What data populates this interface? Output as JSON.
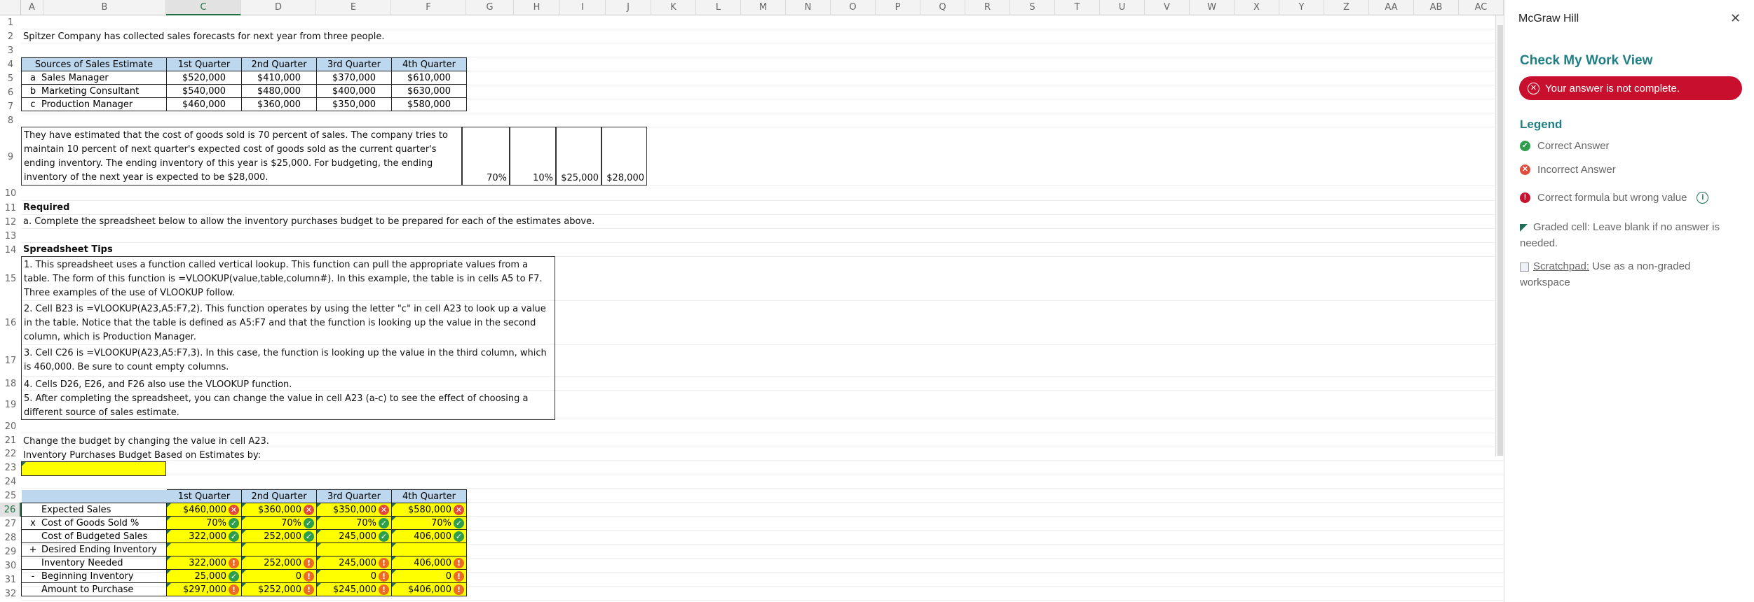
{
  "columns": [
    "A",
    "B",
    "C",
    "D",
    "E",
    "F",
    "G",
    "H",
    "I",
    "J",
    "K",
    "L",
    "M",
    "N",
    "O",
    "P",
    "Q",
    "R",
    "S",
    "T",
    "U",
    "V",
    "W",
    "X",
    "Y",
    "Z",
    "AA",
    "AB",
    "AC"
  ],
  "rows": [
    "1",
    "2",
    "3",
    "4",
    "5",
    "6",
    "7",
    "8",
    "9",
    "10",
    "11",
    "12",
    "13",
    "14",
    "15",
    "16",
    "17",
    "18",
    "19",
    "20",
    "21",
    "22",
    "23",
    "24",
    "25",
    "26",
    "27",
    "28",
    "29",
    "30",
    "31",
    "32"
  ],
  "intro": "Spitzer Company has collected sales forecasts for next year from three people.",
  "sources": {
    "header": [
      "Sources of Sales Estimate",
      "1st Quarter",
      "2nd Quarter",
      "3rd Quarter",
      "4th Quarter"
    ],
    "rows": [
      {
        "letter": "a",
        "name": "Sales Manager",
        "q": [
          "$520,000",
          "$410,000",
          "$370,000",
          "$610,000"
        ]
      },
      {
        "letter": "b",
        "name": "Marketing Consultant",
        "q": [
          "$540,000",
          "$480,000",
          "$400,000",
          "$630,000"
        ]
      },
      {
        "letter": "c",
        "name": "Production Manager",
        "q": [
          "$460,000",
          "$360,000",
          "$350,000",
          "$580,000"
        ]
      }
    ]
  },
  "estimate_text": "They have estimated that the cost of goods sold is 70 percent of sales. The company tries to maintain 10 percent of next quarter's expected cost of goods sold as the current quarter's ending inventory. The ending inventory of this year is $25,000. For budgeting, the ending inventory of the next year is expected to be $28,000.",
  "assumptions": [
    "70%",
    "10%",
    "$25,000",
    "$28,000"
  ],
  "required_label": "Required",
  "required_text": "a. Complete the spreadsheet below to allow the inventory purchases budget to be prepared for each of the estimates above.",
  "tips_label": "Spreadsheet Tips",
  "tips": [
    "1. This spreadsheet uses a function called vertical lookup. This function can pull the appropriate values from a table. The form of this function is =VLOOKUP(value,table,column#). In this example, the table is in cells A5 to F7. Three examples of the use of VLOOKUP follow.",
    "2. Cell B23 is =VLOOKUP(A23,A5:F7,2). This function operates by using the letter \"c\" in cell A23 to look up a value in the table. Notice that the table is defined as A5:F7 and that the function is looking up the value in the second column, which is Production Manager.",
    "3. Cell C26 is =VLOOKUP(A23,A5:F7,3). In this case, the function is looking up the value in the third column, which is 460,000. Be sure to count empty columns.",
    "4. Cells D26, E26, and F26 also use the VLOOKUP function.",
    "5. After completing the spreadsheet, you can change the value in cell A23 (a-c) to see the effect of choosing a different source of sales estimate."
  ],
  "change_text": "Change the budget by changing the value in cell A23.",
  "budget_title": "Inventory Purchases Budget Based on Estimates by:",
  "budget": {
    "header": [
      "1st Quarter",
      "2nd Quarter",
      "3rd Quarter",
      "4th Quarter"
    ],
    "rows": [
      {
        "op": "",
        "label": "Expected Sales",
        "cells": [
          {
            "v": "$460,000",
            "s": "bad"
          },
          {
            "v": "$360,000",
            "s": "bad"
          },
          {
            "v": "$350,000",
            "s": "bad"
          },
          {
            "v": "$580,000",
            "s": "bad"
          }
        ]
      },
      {
        "op": "x",
        "label": "Cost of Goods Sold %",
        "cells": [
          {
            "v": "70%",
            "s": "ok"
          },
          {
            "v": "70%",
            "s": "ok"
          },
          {
            "v": "70%",
            "s": "ok"
          },
          {
            "v": "70%",
            "s": "ok"
          }
        ]
      },
      {
        "op": "",
        "label": "Cost of Budgeted Sales",
        "cells": [
          {
            "v": "322,000",
            "s": "ok"
          },
          {
            "v": "252,000",
            "s": "ok"
          },
          {
            "v": "245,000",
            "s": "ok"
          },
          {
            "v": "406,000",
            "s": "ok"
          }
        ]
      },
      {
        "op": "+",
        "label": "Desired Ending Inventory",
        "cells": [
          {
            "v": "",
            "s": ""
          },
          {
            "v": "",
            "s": ""
          },
          {
            "v": "",
            "s": ""
          },
          {
            "v": "",
            "s": ""
          }
        ]
      },
      {
        "op": "",
        "label": "Inventory Needed",
        "cells": [
          {
            "v": "322,000",
            "s": "warn"
          },
          {
            "v": "252,000",
            "s": "warn"
          },
          {
            "v": "245,000",
            "s": "warn"
          },
          {
            "v": "406,000",
            "s": "warn"
          }
        ]
      },
      {
        "op": "-",
        "label": "Beginning Inventory",
        "cells": [
          {
            "v": "25,000",
            "s": "ok"
          },
          {
            "v": "0",
            "s": "warn"
          },
          {
            "v": "0",
            "s": "warn"
          },
          {
            "v": "0",
            "s": "warn"
          }
        ]
      },
      {
        "op": "",
        "label": "Amount to Purchase",
        "cells": [
          {
            "v": "$297,000",
            "s": "warn"
          },
          {
            "v": "$252,000",
            "s": "warn"
          },
          {
            "v": "$245,000",
            "s": "warn"
          },
          {
            "v": "$406,000",
            "s": "warn"
          }
        ]
      }
    ]
  },
  "panel": {
    "brand": "McGraw Hill",
    "close_glyph": "✕",
    "title": "Check My Work View",
    "status": "Your answer is not complete.",
    "legend_title": "Legend",
    "legend": {
      "correct": "Correct Answer",
      "incorrect": "Incorrect Answer",
      "formula": "Correct formula but wrong value",
      "graded": "Graded cell: Leave blank if no answer is needed.",
      "scratch_link": "Scratchpad:",
      "scratch_rest": " Use as a non-graded workspace"
    }
  },
  "colors": {
    "accent": "#1f7f85",
    "error": "#c8102e",
    "highlight": "#ffff00",
    "header_blue": "#bdd7ee"
  },
  "icons": {
    "correct": "check-circle-icon",
    "incorrect": "x-circle-icon",
    "warning": "exclamation-circle-icon",
    "info": "info-icon",
    "close": "close-icon"
  }
}
